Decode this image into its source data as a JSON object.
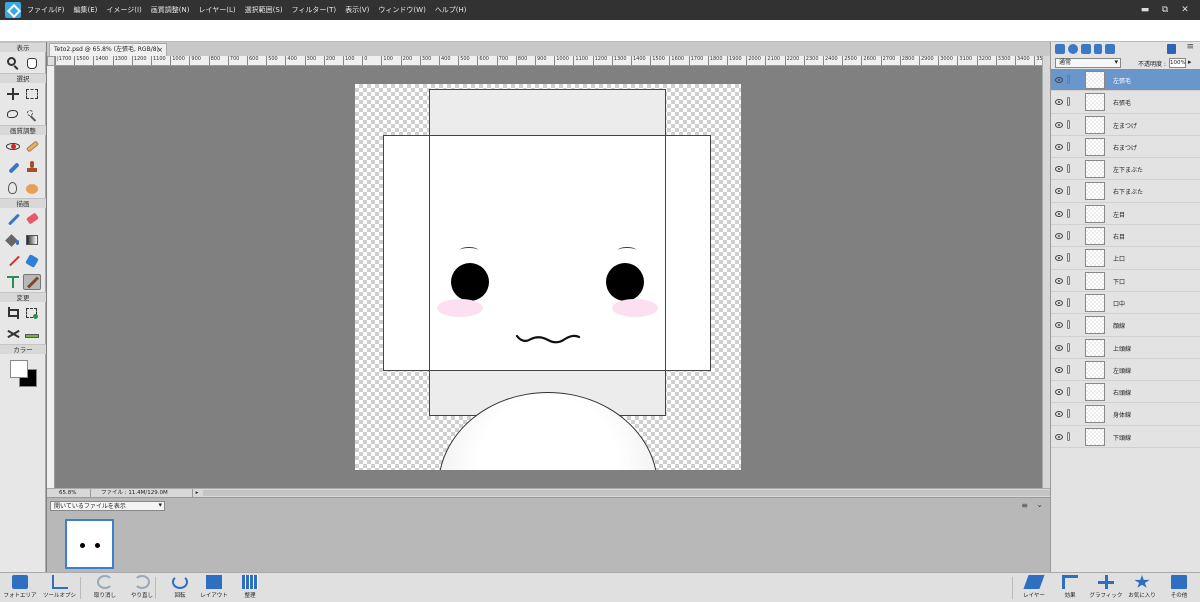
{
  "menubar": {
    "items": [
      "ファイル(F)",
      "編集(E)",
      "イメージ(I)",
      "画質調整(N)",
      "レイヤー(L)",
      "選択範囲(S)",
      "フィルター(T)",
      "表示(V)",
      "ウィンドウ(W)",
      "ヘルプ(H)"
    ],
    "window_controls": [
      "▬",
      "⧉",
      "✕"
    ]
  },
  "toolbox": {
    "sections": [
      "表示",
      "選択",
      "画質調整",
      "描画",
      "変更",
      "カラー"
    ]
  },
  "document": {
    "tab_title": "Teto2.psd @ 65.8% (左張毛, RGB/8)",
    "tab_close": "×"
  },
  "rulers": {
    "horizontal_ticks": [
      "|1700",
      "1500",
      "1400",
      "1300",
      "1200",
      "1100",
      "1000",
      "900",
      "800",
      "700",
      "600",
      "500",
      "400",
      "300",
      "200",
      "100",
      "0",
      "100",
      "200",
      "300",
      "400",
      "500",
      "600",
      "700",
      "800",
      "900",
      "1000",
      "1100",
      "1200",
      "1300",
      "1400",
      "1500",
      "1600",
      "1700",
      "1800",
      "1900",
      "2000",
      "2100",
      "2200",
      "2300",
      "2400",
      "2500",
      "2600",
      "2700",
      "2800",
      "2900",
      "3000",
      "3100",
      "3200",
      "3300",
      "3400",
      "3500"
    ]
  },
  "statusbar": {
    "zoom": "65.8%",
    "file_info": "ファイル : 11.4M/129.0M",
    "arrow": "▸"
  },
  "photobin": {
    "select_value": "開いているファイルを表示",
    "menu_icon": "≡",
    "collapse_icon": "⌄"
  },
  "layers": {
    "blend_mode": "通常",
    "opacity_label": "不透明度 :",
    "opacity_value": "100%",
    "menu_icon": "≡",
    "items": [
      {
        "name": "左張毛",
        "selected": true
      },
      {
        "name": "右張毛"
      },
      {
        "name": "左まつげ"
      },
      {
        "name": "右まつげ"
      },
      {
        "name": "左下まぶた"
      },
      {
        "name": "右下まぶた"
      },
      {
        "name": "左目"
      },
      {
        "name": "右目"
      },
      {
        "name": "上口"
      },
      {
        "name": "下口"
      },
      {
        "name": "口中"
      },
      {
        "name": "顔線"
      },
      {
        "name": "上頭線"
      },
      {
        "name": "左頭線"
      },
      {
        "name": "右頭線"
      },
      {
        "name": "身体線"
      },
      {
        "name": "下頭線"
      }
    ]
  },
  "taskbar": {
    "left": [
      {
        "label": "フォトエリア",
        "icon": "photo-bin-icon"
      },
      {
        "label": "ツールオプション",
        "icon": "tool-options-icon"
      },
      {
        "label": "取り消し",
        "icon": "undo-icon"
      },
      {
        "label": "やり直し",
        "icon": "redo-icon"
      },
      {
        "label": "回転",
        "icon": "rotate-icon"
      },
      {
        "label": "レイアウト",
        "icon": "layout-icon"
      },
      {
        "label": "整理",
        "icon": "organizer-icon"
      }
    ],
    "right": [
      {
        "label": "レイヤー",
        "icon": "layers-icon"
      },
      {
        "label": "効果",
        "icon": "fx-icon"
      },
      {
        "label": "グラフィック",
        "icon": "add-icon"
      },
      {
        "label": "お気に入り",
        "icon": "star-icon"
      },
      {
        "label": "その他",
        "icon": "more-icon"
      }
    ]
  },
  "colors": {
    "accent": "#3b7fcf",
    "menubar_bg": "#323232",
    "selected_layer": "#6b96cc",
    "blush": "#fbe0f1"
  }
}
